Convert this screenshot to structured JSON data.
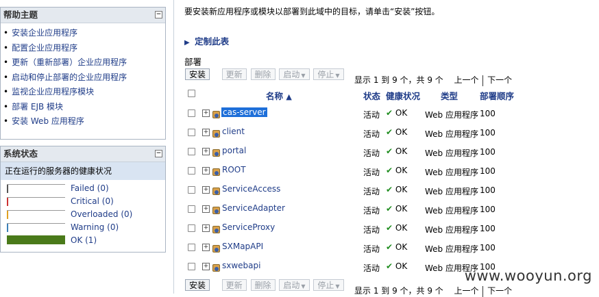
{
  "help_panel": {
    "title": "帮助主题",
    "items": [
      "安装企业应用程序",
      "配置企业应用程序",
      "更新（重新部署）企业应用程序",
      "启动和停止部署的企业应用程序",
      "监视企业应用程序模块",
      "部署 EJB 模块",
      "安装 Web 应用程序"
    ]
  },
  "status_panel": {
    "title": "系统状态",
    "subtitle": "正在运行的服务器的健康状况",
    "rows": [
      {
        "label": "Failed (0)",
        "color": "#555555",
        "fraction": 0
      },
      {
        "label": "Critical (0)",
        "color": "#cc3333",
        "fraction": 0
      },
      {
        "label": "Overloaded (0)",
        "color": "#e0a020",
        "fraction": 0
      },
      {
        "label": "Warning (0)",
        "color": "#3a7fb8",
        "fraction": 0
      },
      {
        "label": "OK (1)",
        "color": "#4a7a1a",
        "fraction": 1
      }
    ]
  },
  "intro_text": "要安装新应用程序或模块以部署到此域中的目标，请单击“安装”按钮。",
  "customize_link": "定制此表",
  "section_title": "部署",
  "toolbar": {
    "install": "安装",
    "update": "更新",
    "delete": "删除",
    "start": "启动",
    "stop": "停止",
    "paging": "显示 1 到 9 个，共 9 个",
    "prev": "上一个",
    "next": "下一个"
  },
  "columns": {
    "name": "名称",
    "state": "状态",
    "health": "健康状况",
    "type": "类型",
    "order": "部署顺序"
  },
  "deployments": [
    {
      "name": "cas-server",
      "state": "活动",
      "health": "OK",
      "type": "Web 应用程序",
      "order": "100"
    },
    {
      "name": "client",
      "state": "活动",
      "health": "OK",
      "type": "Web 应用程序",
      "order": "100"
    },
    {
      "name": "portal",
      "state": "活动",
      "health": "OK",
      "type": "Web 应用程序",
      "order": "100"
    },
    {
      "name": "ROOT",
      "state": "活动",
      "health": "OK",
      "type": "Web 应用程序",
      "order": "100"
    },
    {
      "name": "ServiceAccess",
      "state": "活动",
      "health": "OK",
      "type": "Web 应用程序",
      "order": "100"
    },
    {
      "name": "ServiceAdapter",
      "state": "活动",
      "health": "OK",
      "type": "Web 应用程序",
      "order": "100"
    },
    {
      "name": "ServiceProxy",
      "state": "活动",
      "health": "OK",
      "type": "Web 应用程序",
      "order": "100"
    },
    {
      "name": "SXMapAPI",
      "state": "活动",
      "health": "OK",
      "type": "Web 应用程序",
      "order": "100"
    },
    {
      "name": "sxwebapi",
      "state": "活动",
      "health": "OK",
      "type": "Web 应用程序",
      "order": "100"
    }
  ],
  "watermark": "www.wooyun.org"
}
